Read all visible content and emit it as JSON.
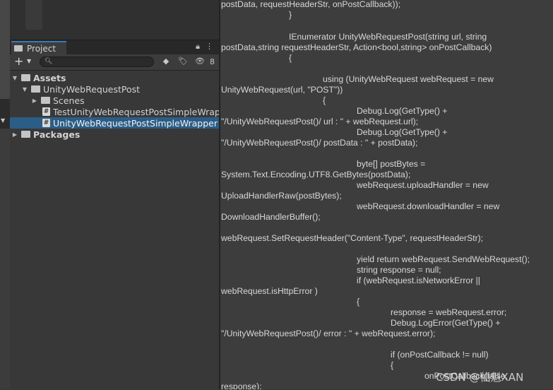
{
  "project_window": {
    "tab_label": "Project",
    "lock_icon": "lock-icon",
    "menu_icon": "kebab-menu-icon",
    "add_label": "+",
    "hidden_count": "8",
    "tree": [
      {
        "label": "Assets",
        "type": "folder-open",
        "depth": 0,
        "expanded": true,
        "bold": true
      },
      {
        "label": "UnityWebRequestPost",
        "type": "folder-open",
        "depth": 1,
        "expanded": true
      },
      {
        "label": "Scenes",
        "type": "folder",
        "depth": 2,
        "expanded": false
      },
      {
        "label": "TestUnityWebRequestPostSimpleWrapper",
        "type": "script",
        "depth": 2
      },
      {
        "label": "UnityWebRequestPostSimpleWrapper",
        "type": "script",
        "depth": 2,
        "selected": true
      },
      {
        "label": "Packages",
        "type": "folder",
        "depth": 0,
        "expanded": false,
        "bold": true
      }
    ]
  },
  "code_lines": [
    "postData, requestHeaderStr, onPostCallback));",
    "}",
    "IEnumerator UnityWebRequestPost(string url, string",
    "postData,string requestHeaderStr, Action<bool,string> onPostCallback)",
    "{",
    "using (UnityWebRequest webRequest = new",
    "UnityWebRequest(url, \"POST\"))",
    "{",
    "Debug.Log(GetType() +",
    "\"/UnityWebRequestPost()/ url : \" + webRequest.url);",
    "Debug.Log(GetType() +",
    "\"/UnityWebRequestPost()/ postData : \" + postData);",
    "byte[] postBytes =",
    "System.Text.Encoding.UTF8.GetBytes(postData);",
    "webRequest.uploadHandler = new",
    "UploadHandlerRaw(postBytes);",
    "webRequest.downloadHandler = new",
    "DownloadHandlerBuffer();",
    "webRequest.SetRequestHeader(\"Content-Type\", requestHeaderStr);",
    "yield return webRequest.SendWebRequest();",
    "string response = null;",
    "if (webRequest.isNetworkError ||",
    "webRequest.isHttpError )",
    "{",
    "response = webRequest.error;",
    "Debug.LogError(GetType() +",
    "\"/UnityWebRequestPost()/ error : \" + webRequest.error);",
    "if (onPostCallback != null)",
    "{",
    "onPostCallback(false,",
    "response);"
  ],
  "watermark": "CSDN @仙魁XAN",
  "colors": {
    "selection": "#2c5d87",
    "tab_accent": "#3a79bb",
    "panel_bg": "#383838",
    "code_bg": "#3d3d3d"
  }
}
